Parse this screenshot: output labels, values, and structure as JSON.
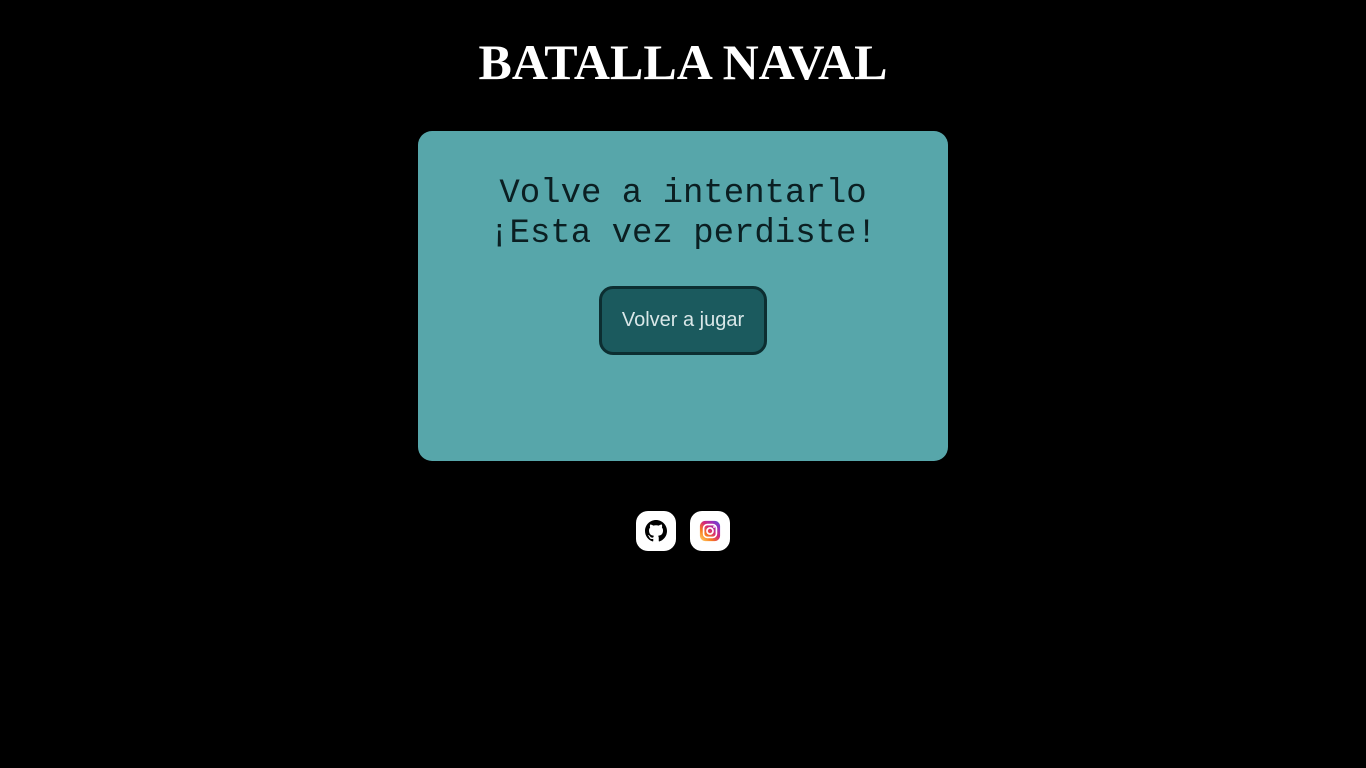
{
  "header": {
    "title": "BATALLA NAVAL"
  },
  "game_panel": {
    "message_line_1": "Volve a intentarlo",
    "message_line_2": "¡Esta vez perdiste!",
    "play_again_label": "Volver a jugar"
  },
  "social_links": [
    {
      "icon": "github-icon"
    },
    {
      "icon": "instagram-icon"
    }
  ],
  "colors": {
    "background": "#000000",
    "panel": "#57a6aa",
    "button": "#1b5a5e",
    "button_border": "#0c2e31",
    "button_text": "#d9e7e8",
    "title": "#ffffff"
  }
}
